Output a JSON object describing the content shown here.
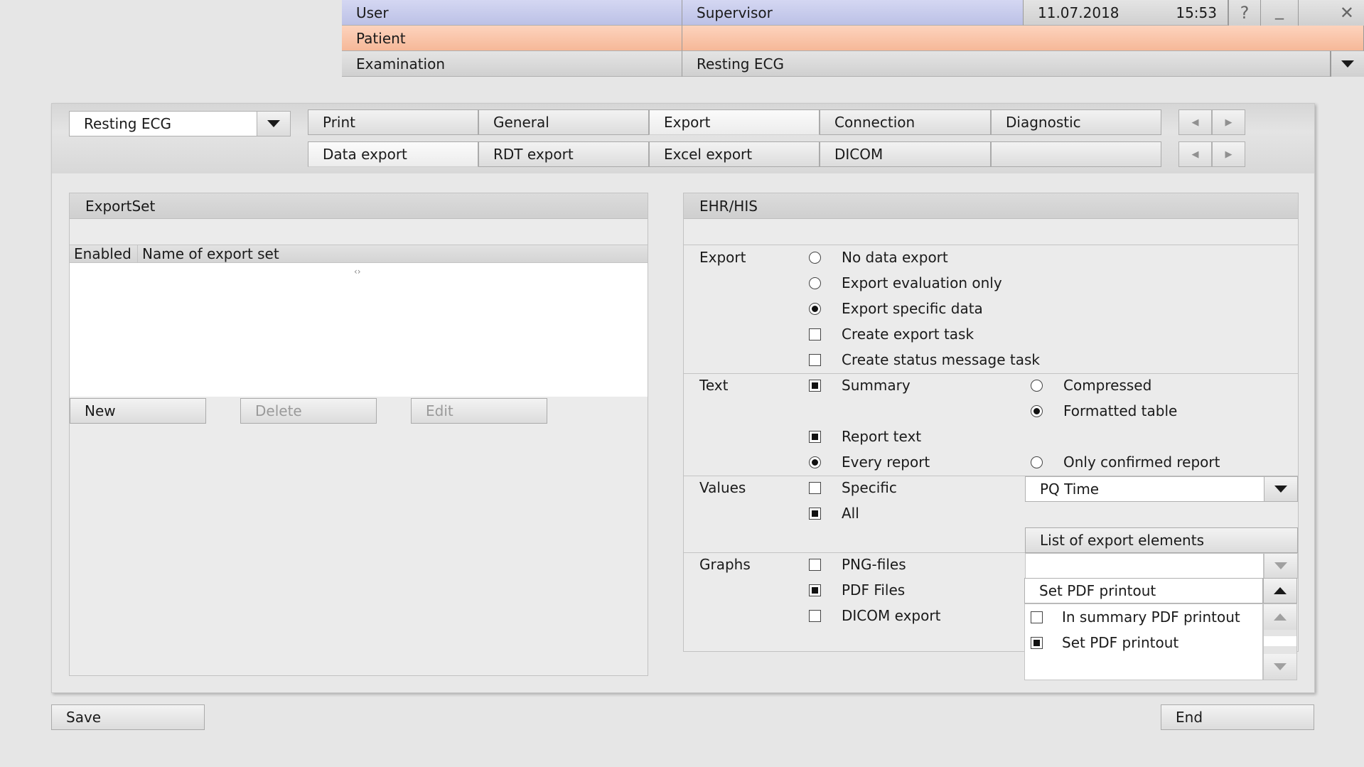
{
  "header": {
    "user_label": "User",
    "user_value": "Supervisor",
    "date": "11.07.2018",
    "time": "15:53",
    "help_icon": "?",
    "minimize_icon": "_",
    "close_icon": "✕",
    "patient_label": "Patient",
    "patient_value": "",
    "examination_label": "Examination",
    "examination_value": "Resting ECG",
    "colors": {
      "user_row": "#c6caeb",
      "patient_row": "#f9c3a6"
    }
  },
  "toolbar": {
    "exam_select": "Resting ECG",
    "tabs_row1": [
      "Print",
      "General",
      "Export",
      "Connection",
      "Diagnostic"
    ],
    "tabs_row2": [
      "Data export",
      "RDT export",
      "Excel export",
      "DICOM",
      ""
    ]
  },
  "exportset": {
    "title": "ExportSet",
    "col_enabled": "Enabled",
    "col_name": "Name of export set",
    "new_btn": "New",
    "delete_btn": "Delete",
    "edit_btn": "Edit"
  },
  "ehr": {
    "title": "EHR/HIS",
    "export_label": "Export",
    "opt_no_data": "No data export",
    "opt_eval_only": "Export evaluation only",
    "opt_specific": "Export specific data",
    "chk_export_task": "Create export task",
    "chk_status_task": "Create status message task",
    "text_label": "Text",
    "chk_summary": "Summary",
    "opt_compressed": "Compressed",
    "opt_formatted": "Formatted table",
    "chk_report_text": "Report text",
    "opt_every_report": "Every report",
    "opt_only_confirmed": "Only confirmed report",
    "values_label": "Values",
    "chk_specific": "Specific",
    "chk_all": "All",
    "values_select": "PQ Time",
    "list_export_btn": "List of export elements",
    "graphs_label": "Graphs",
    "chk_png": "PNG-files",
    "chk_pdf": "PDF Files",
    "chk_dicom": "DICOM export",
    "pdf_select": "Set PDF printout",
    "pdf_opt_summary": "In summary PDF printout",
    "pdf_opt_set": "Set PDF printout"
  },
  "footer": {
    "save_btn": "Save",
    "end_btn": "End"
  }
}
